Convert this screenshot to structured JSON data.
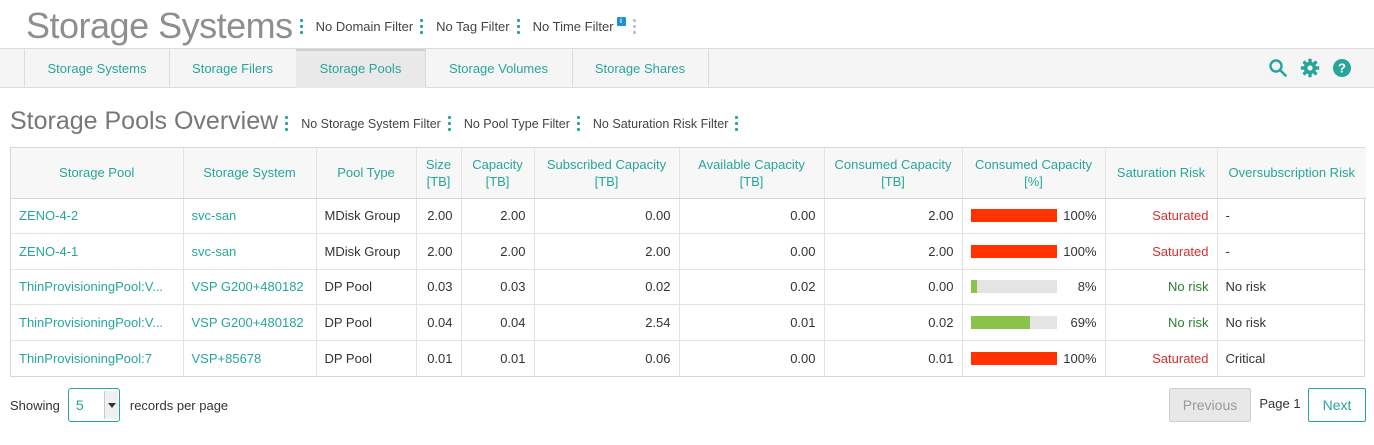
{
  "header": {
    "title": "Storage Systems",
    "filters": [
      "No Domain Filter",
      "No Tag Filter",
      "No Time Filter"
    ],
    "time_filter_badge": "i"
  },
  "tabs": [
    {
      "label": "Storage Systems",
      "active": false
    },
    {
      "label": "Storage Filers",
      "active": false
    },
    {
      "label": "Storage Pools",
      "active": true
    },
    {
      "label": "Storage Volumes",
      "active": false
    },
    {
      "label": "Storage Shares",
      "active": false
    }
  ],
  "toolbar_icons": [
    "search-icon",
    "gear-icon",
    "help-icon"
  ],
  "colors": {
    "accent": "#26a69a",
    "bar_high": "#ff3300",
    "bar_ok": "#8bc34a",
    "risk_saturated": "#d32f2f",
    "risk_none": "#2e7d32"
  },
  "section": {
    "title": "Storage Pools Overview",
    "filters": [
      "No Storage System Filter",
      "No Pool Type Filter",
      "No Saturation Risk Filter"
    ]
  },
  "table": {
    "columns": [
      {
        "line1": "Storage Pool",
        "line2": ""
      },
      {
        "line1": "Storage System",
        "line2": ""
      },
      {
        "line1": "Pool Type",
        "line2": ""
      },
      {
        "line1": "Size",
        "line2": "[TB]"
      },
      {
        "line1": "Capacity",
        "line2": "[TB]"
      },
      {
        "line1": "Subscribed Capacity",
        "line2": "[TB]"
      },
      {
        "line1": "Available Capacity",
        "line2": "[TB]"
      },
      {
        "line1": "Consumed Capacity",
        "line2": "[TB]"
      },
      {
        "line1": "Consumed Capacity",
        "line2": "[%]"
      },
      {
        "line1": "Saturation Risk",
        "line2": ""
      },
      {
        "line1": "Oversubscription Risk",
        "line2": ""
      }
    ],
    "rows": [
      {
        "pool": "ZENO-4-2",
        "system": "svc-san",
        "type": "MDisk Group",
        "size": "2.00",
        "capacity": "2.00",
        "subscribed": "0.00",
        "available": "0.00",
        "consumed": "2.00",
        "consumed_pct": 100,
        "consumed_pct_label": "100%",
        "saturation": "Saturated",
        "saturation_level": "high",
        "oversub": "-"
      },
      {
        "pool": "ZENO-4-1",
        "system": "svc-san",
        "type": "MDisk Group",
        "size": "2.00",
        "capacity": "2.00",
        "subscribed": "2.00",
        "available": "0.00",
        "consumed": "2.00",
        "consumed_pct": 100,
        "consumed_pct_label": "100%",
        "saturation": "Saturated",
        "saturation_level": "high",
        "oversub": "-"
      },
      {
        "pool": "ThinProvisioningPool:V...",
        "system": "VSP G200+480182",
        "type": "DP Pool",
        "size": "0.03",
        "capacity": "0.03",
        "subscribed": "0.02",
        "available": "0.02",
        "consumed": "0.00",
        "consumed_pct": 8,
        "consumed_pct_label": "8%",
        "saturation": "No risk",
        "saturation_level": "none",
        "oversub": "No risk"
      },
      {
        "pool": "ThinProvisioningPool:V...",
        "system": "VSP G200+480182",
        "type": "DP Pool",
        "size": "0.04",
        "capacity": "0.04",
        "subscribed": "2.54",
        "available": "0.01",
        "consumed": "0.02",
        "consumed_pct": 69,
        "consumed_pct_label": "69%",
        "saturation": "No risk",
        "saturation_level": "none",
        "oversub": "No risk"
      },
      {
        "pool": "ThinProvisioningPool:7",
        "system": "VSP+85678",
        "type": "DP Pool",
        "size": "0.01",
        "capacity": "0.01",
        "subscribed": "0.06",
        "available": "0.00",
        "consumed": "0.01",
        "consumed_pct": 100,
        "consumed_pct_label": "100%",
        "saturation": "Saturated",
        "saturation_level": "high",
        "oversub": "Critical"
      }
    ]
  },
  "footer": {
    "showing_label": "Showing",
    "per_page_value": "5",
    "per_page_label": "records per page",
    "previous_label": "Previous",
    "page_label": "Page 1",
    "next_label": "Next"
  }
}
